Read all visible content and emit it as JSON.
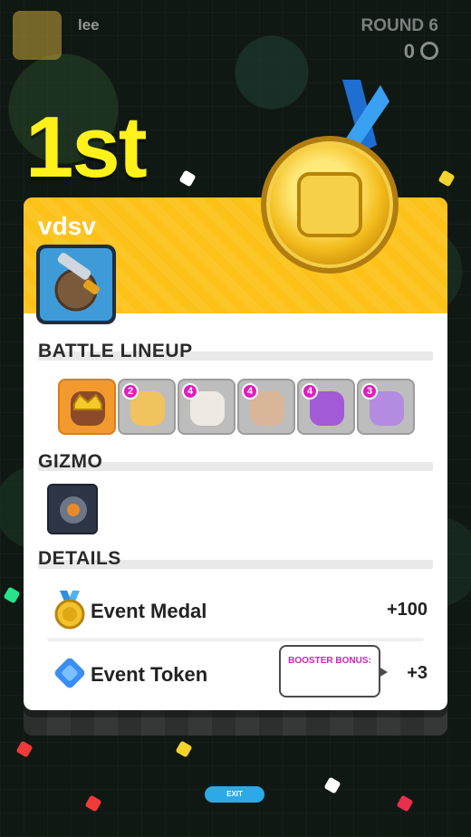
{
  "hud": {
    "player_name": "lee",
    "round_label": "ROUND 6",
    "score": "0"
  },
  "result": {
    "place": "1st"
  },
  "card": {
    "player_name": "vdsv",
    "battle_lineup_title": "BATTLE LINEUP",
    "gizmo_title": "GIZMO",
    "details_title": "DETAILS",
    "lineup": [
      {
        "level": "",
        "icon": "leader-crown-icon"
      },
      {
        "level": "2",
        "icon": "barbarian-face-icon"
      },
      {
        "level": "4",
        "icon": "white-hair-face-icon"
      },
      {
        "level": "4",
        "icon": "bald-face-icon"
      },
      {
        "level": "4",
        "icon": "purple-hair-face-icon"
      },
      {
        "level": "3",
        "icon": "purple-hood-face-icon"
      }
    ],
    "details": {
      "event_medal_label": "Event Medal",
      "event_medal_value": "+100",
      "event_token_label": "Event Token",
      "event_token_value": "+3",
      "booster_label": "BOOSTER BONUS:"
    }
  },
  "footer": {
    "exit_label": "EXIT"
  },
  "colors": {
    "accent_yellow": "#fcc21a",
    "place_yellow": "#fff21a",
    "level_badge": "#e21cc0",
    "exit_blue": "#2ba9e8"
  }
}
